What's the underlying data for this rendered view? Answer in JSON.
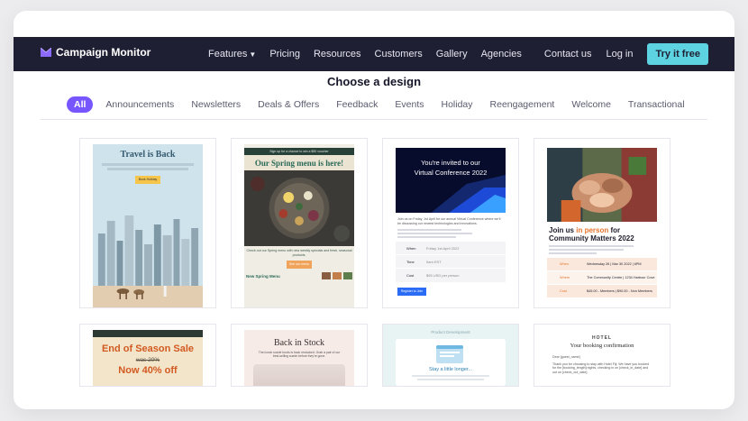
{
  "nav": {
    "brand": "Campaign Monitor",
    "links": [
      "Features",
      "Pricing",
      "Resources",
      "Customers",
      "Gallery",
      "Agencies"
    ],
    "contact": "Contact us",
    "login": "Log in",
    "cta": "Try it free"
  },
  "page": {
    "heading": "Choose a design",
    "filters": [
      "All",
      "Announcements",
      "Newsletters",
      "Deals & Offers",
      "Feedback",
      "Events",
      "Holiday",
      "Reengagement",
      "Welcome",
      "Transactional"
    ]
  },
  "cards": {
    "travel": {
      "title": "Travel is Back",
      "button": "Book Holiday"
    },
    "spring": {
      "banner": "Sign up for a chance to win a $50 voucher",
      "title": "Our Spring menu is here!",
      "text": "Check out our Spring menu with new weekly specials and fresh, seasonal products.",
      "button": "See our menu",
      "footer": "New Spring Menu"
    },
    "conference": {
      "title_line1": "You're invited to our",
      "title_line2": "Virtual Conference 2022",
      "intro": "Join us on Friday, 1st April for our annual Virtual Conference where we'll be discussing our newest technologies and innovations.",
      "rows": [
        [
          "When",
          "Friday 1st April 2022"
        ],
        [
          "Time",
          "9am EST"
        ],
        [
          "Cost",
          "$95 USD per person"
        ]
      ],
      "button": "Register to Join"
    },
    "community": {
      "title_part1": "Join us ",
      "title_accent": "in person",
      "title_part2": " for Community Matters 2022",
      "rows": [
        [
          "When",
          "Wednesday 26 | Mar 30 2022 | 6PM"
        ],
        [
          "Where",
          "The Community Centre | 1234 Harbour Cove"
        ],
        [
          "Cost",
          "$45.00 - Members | $90.00 - Non Members"
        ]
      ]
    },
    "sale": {
      "title": "End of Season Sale",
      "strike": "was 20%",
      "now": "Now 40% off"
    },
    "stock": {
      "title": "Back in Stock",
      "text": "The iconic suede boots is back restocked. Grab a pair of our best-selling suede before they're gone."
    },
    "product": {
      "header": "Product Development",
      "title": "Stay a little longer..."
    },
    "hotel": {
      "brand": "HOTEL",
      "title": "Your booking confirmation",
      "greeting": "Dear [guest_name]",
      "body": "Thank you for choosing to stay with Hotel Fiji. We have you booked for the [booking_length] nights, checking in on [check_in_date] and out on [check_out_date]."
    }
  },
  "colors": {
    "nav_bg": "#1f1f33",
    "accent": "#7856ff",
    "cta": "#5dd3e2"
  }
}
